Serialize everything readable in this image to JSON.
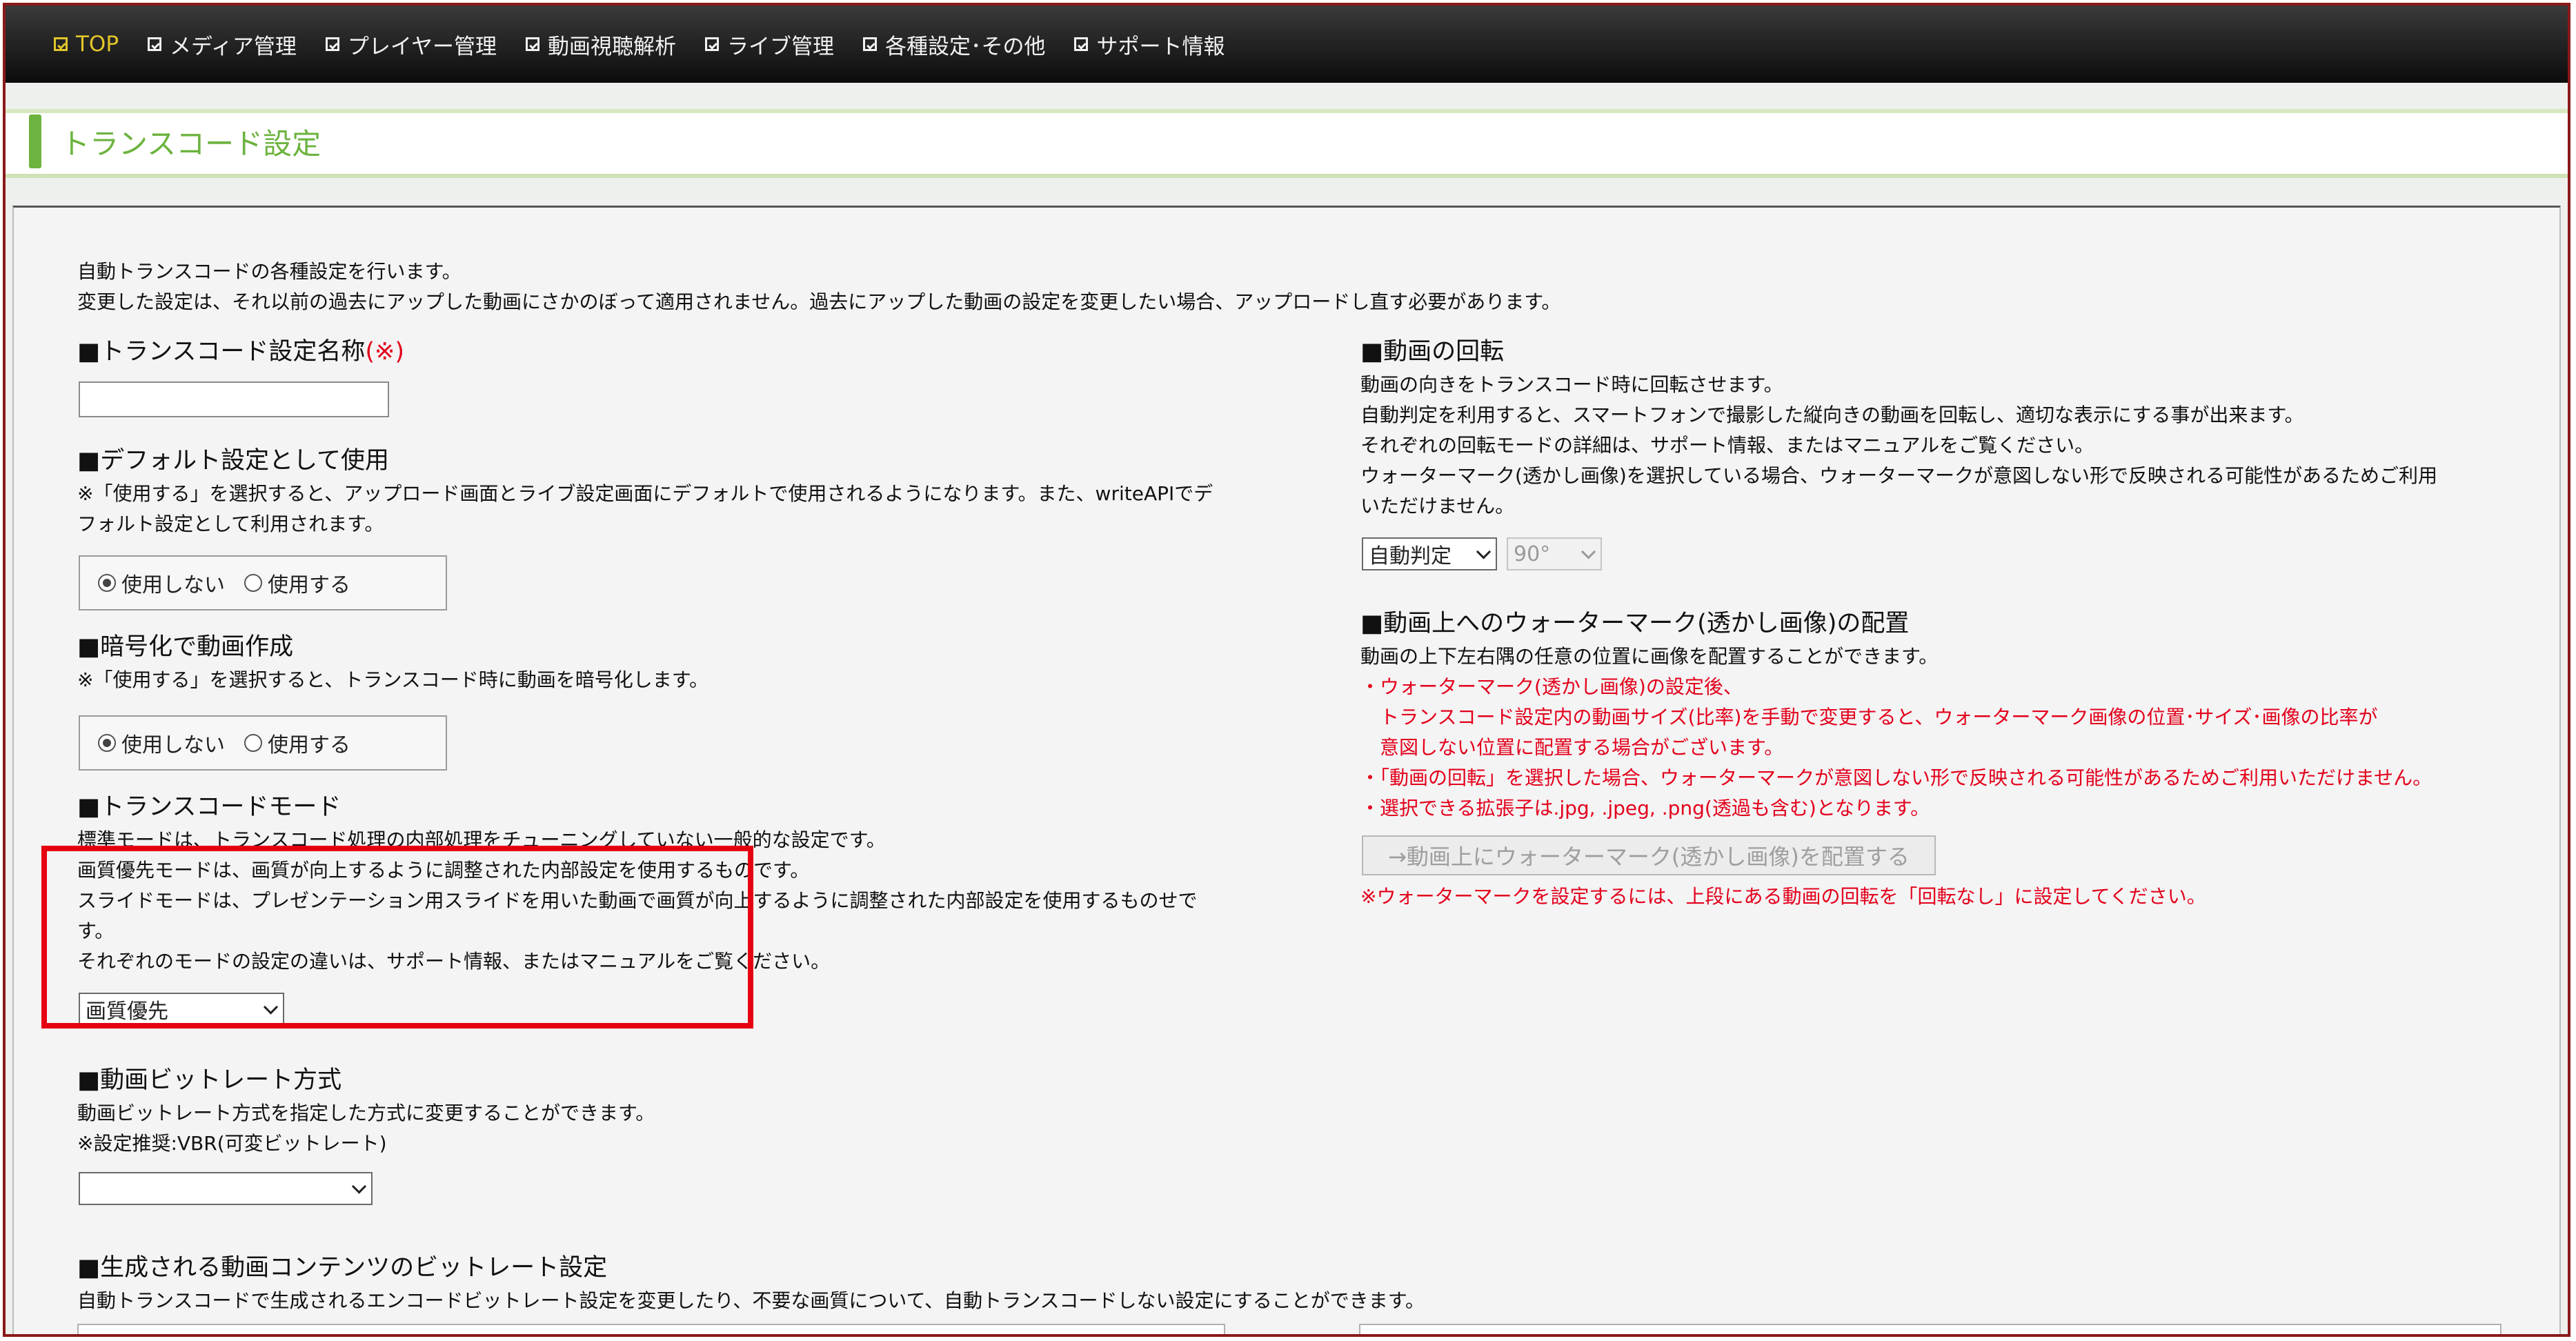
{
  "nav": {
    "items": [
      {
        "label": "TOP"
      },
      {
        "label": "メディア管理"
      },
      {
        "label": "プレイヤー管理"
      },
      {
        "label": "動画視聴解析"
      },
      {
        "label": "ライブ管理"
      },
      {
        "label": "各種設定･その他"
      },
      {
        "label": "サポート情報"
      }
    ]
  },
  "page": {
    "title": "トランスコード設定"
  },
  "intro": {
    "line1": "自動トランスコードの各種設定を行います。",
    "line2": "変更した設定は、それ以前の過去にアップした動画にさかのぼって適用されません。過去にアップした動画の設定を変更したい場合、アップロードし直す必要があります。"
  },
  "settings_name": {
    "heading": "■トランスコード設定名称",
    "required_mark": "(※)",
    "value": ""
  },
  "default_use": {
    "heading": "■デフォルト設定として使用",
    "note1": "※「使用する」を選択すると、アップロード画面とライブ設定画面にデフォルトで使用されるようになります。また、writeAPIでデ",
    "note2": "フォルト設定として利用されます。",
    "options": [
      "使用しない",
      "使用する"
    ],
    "selected": "使用しない"
  },
  "encryption": {
    "heading": "■暗号化で動画作成",
    "note": "※「使用する」を選択すると、トランスコード時に動画を暗号化します。",
    "options": [
      "使用しない",
      "使用する"
    ],
    "selected": "使用しない"
  },
  "transcode_mode": {
    "heading": "■トランスコードモード",
    "lines": [
      "標準モードは、トランスコード処理の内部処理をチューニングしていない一般的な設定です。",
      "画質優先モードは、画質が向上するように調整された内部設定を使用するものです。",
      "スライドモードは、プレゼンテーション用スライドを用いた動画で画質が向上するように調整された内部設定を使用するものせで",
      "す。",
      "それぞれのモードの設定の違いは、サポート情報、またはマニュアルをご覧ください。"
    ],
    "selected": "画質優先"
  },
  "bitrate_mode": {
    "heading": "■動画ビットレート方式",
    "line1": "動画ビットレート方式を指定した方式に変更することができます。",
    "line2": "※設定推奨:VBR(可変ビットレート)",
    "selected": ""
  },
  "content_bitrate": {
    "heading": "■生成される動画コンテンツのビットレート設定",
    "line1": "自動トランスコードで生成されるエンコードビットレート設定を変更したり、不要な画質について、自動トランスコードしない設定にすることができます。"
  },
  "rotation": {
    "heading": "■動画の回転",
    "lines": [
      "動画の向きをトランスコード時に回転させます。",
      "自動判定を利用すると、スマートフォンで撮影した縦向きの動画を回転し、適切な表示にする事が出来ます。",
      "それぞれの回転モードの詳細は、サポート情報、またはマニュアルをご覧ください。",
      "ウォーターマーク(透かし画像)を選択している場合、ウォーターマークが意図しない形で反映される可能性があるためご利用",
      "いただけません。"
    ],
    "mode_selected": "自動判定",
    "angle_selected": "90°"
  },
  "watermark": {
    "heading": "■動画上へのウォーターマーク(透かし画像)の配置",
    "line1": "動画の上下左右隅の任意の位置に画像を配置することができます。",
    "red_lines": [
      "・ウォーターマーク(透かし画像)の設定後、",
      "　トランスコード設定内の動画サイズ(比率)を手動で変更すると、ウォーターマーク画像の位置･サイズ･画像の比率が",
      "　意図しない位置に配置する場合がございます。",
      "・「動画の回転」を選択した場合、ウォーターマークが意図しない形で反映される可能性があるためご利用いただけません。",
      "・選択できる拡張子は.jpg, .jpeg, .png(透過も含む)となります。"
    ],
    "button_label": "→動画上にウォーターマーク(透かし画像)を配置する",
    "warning": "※ウォーターマークを設定するには、上段にある動画の回転を「回転なし」に設定してください。"
  }
}
